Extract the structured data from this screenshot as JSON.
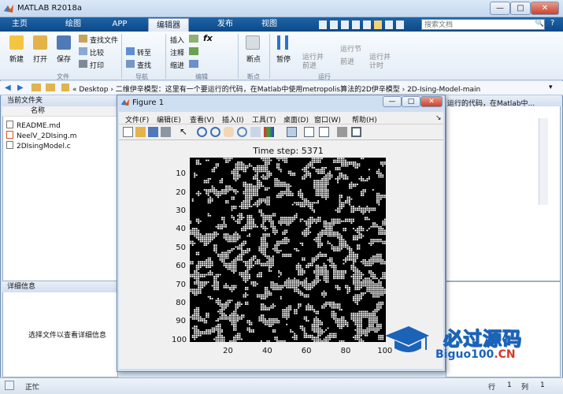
{
  "app": {
    "title": "MATLAB R2018a"
  },
  "window_buttons": {
    "minimize": "—",
    "maximize": "□",
    "close": "✕"
  },
  "tabs": [
    "主页",
    "绘图",
    "APP",
    "编辑器",
    "发布",
    "视图"
  ],
  "search": {
    "placeholder": "搜索文档"
  },
  "toolstrip": {
    "file": {
      "new": "新建",
      "open": "打开",
      "save": "保存",
      "find_files": "查找文件",
      "compare": "比较",
      "print": "打印",
      "section": "文件"
    },
    "navigate": {
      "goto": "转至",
      "find": "查找",
      "section": "导航"
    },
    "edit": {
      "insert": "插入",
      "comment": "注释",
      "indent": "缩进",
      "fx": "fx",
      "section": "编辑"
    },
    "breakpoints": {
      "label": "断点",
      "section": "断点"
    },
    "run": {
      "pause": "暂停",
      "run_advance": "运行并前进",
      "run_section": "运行节",
      "advance": "前进",
      "run_time": "运行并计时",
      "section": "运行"
    }
  },
  "address": {
    "path": "« Desktop › 二维伊辛模型：这里有一个要运行的代码，在Matlab中使用metropolis算法的2D伊辛模型 › 2D-Ising-Model-main",
    "right_text": "运行的代码，在Matlab中..."
  },
  "current_folder": {
    "title": "当前文件夹",
    "column": "名称",
    "files": [
      "README.md",
      "NeelV_2DIsing.m",
      "2DIsingModel.c"
    ]
  },
  "details": {
    "title": "详细信息",
    "message": "选择文件以查看详细信息"
  },
  "status": {
    "text": "正忙",
    "row_label": "行",
    "row": "1",
    "col_label": "列",
    "col": "1"
  },
  "figure": {
    "title": "Figure 1",
    "menu": [
      "文件(F)",
      "编辑(E)",
      "查看(V)",
      "插入(I)",
      "工具(T)",
      "桌面(D)",
      "窗口(W)",
      "帮助(H)"
    ]
  },
  "chart_data": {
    "type": "heatmap",
    "title": "Time step: 5371",
    "xlabel": "",
    "ylabel": "",
    "grid_size": 100,
    "x_ticks": [
      20,
      40,
      60,
      80,
      100
    ],
    "y_ticks": [
      10,
      20,
      30,
      40,
      50,
      60,
      70,
      80,
      90,
      100
    ],
    "xlim": [
      0.5,
      100.5
    ],
    "ylim": [
      0.5,
      100.5
    ],
    "colors": {
      "spin_up": "#ffffff",
      "spin_down": "#000000"
    },
    "spin_up_fraction": 0.38
  },
  "watermark": {
    "text": "必过源码",
    "url": "Biguo100",
    "url_suffix": ".CN"
  },
  "colors": {
    "ribbon": "#1e65a8",
    "accent": "#1b63b8"
  }
}
